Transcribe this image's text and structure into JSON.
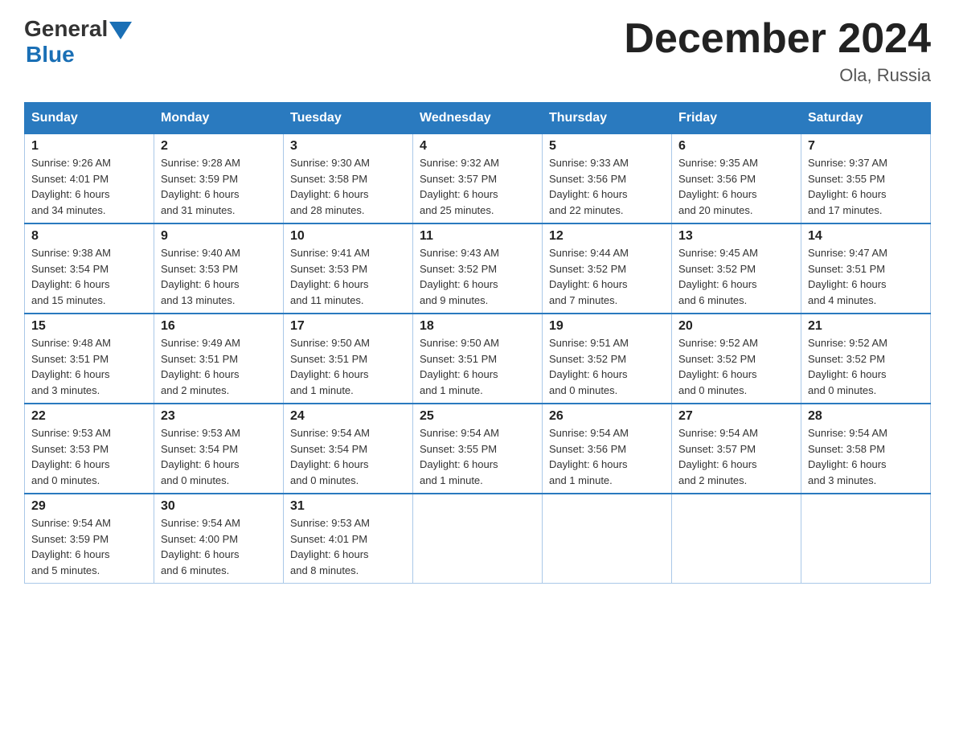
{
  "header": {
    "logo_general": "General",
    "logo_blue": "Blue",
    "month_title": "December 2024",
    "location": "Ola, Russia"
  },
  "days_of_week": [
    "Sunday",
    "Monday",
    "Tuesday",
    "Wednesday",
    "Thursday",
    "Friday",
    "Saturday"
  ],
  "weeks": [
    [
      {
        "day": "1",
        "sunrise": "9:26 AM",
        "sunset": "4:01 PM",
        "daylight": "6 hours and 34 minutes."
      },
      {
        "day": "2",
        "sunrise": "9:28 AM",
        "sunset": "3:59 PM",
        "daylight": "6 hours and 31 minutes."
      },
      {
        "day": "3",
        "sunrise": "9:30 AM",
        "sunset": "3:58 PM",
        "daylight": "6 hours and 28 minutes."
      },
      {
        "day": "4",
        "sunrise": "9:32 AM",
        "sunset": "3:57 PM",
        "daylight": "6 hours and 25 minutes."
      },
      {
        "day": "5",
        "sunrise": "9:33 AM",
        "sunset": "3:56 PM",
        "daylight": "6 hours and 22 minutes."
      },
      {
        "day": "6",
        "sunrise": "9:35 AM",
        "sunset": "3:56 PM",
        "daylight": "6 hours and 20 minutes."
      },
      {
        "day": "7",
        "sunrise": "9:37 AM",
        "sunset": "3:55 PM",
        "daylight": "6 hours and 17 minutes."
      }
    ],
    [
      {
        "day": "8",
        "sunrise": "9:38 AM",
        "sunset": "3:54 PM",
        "daylight": "6 hours and 15 minutes."
      },
      {
        "day": "9",
        "sunrise": "9:40 AM",
        "sunset": "3:53 PM",
        "daylight": "6 hours and 13 minutes."
      },
      {
        "day": "10",
        "sunrise": "9:41 AM",
        "sunset": "3:53 PM",
        "daylight": "6 hours and 11 minutes."
      },
      {
        "day": "11",
        "sunrise": "9:43 AM",
        "sunset": "3:52 PM",
        "daylight": "6 hours and 9 minutes."
      },
      {
        "day": "12",
        "sunrise": "9:44 AM",
        "sunset": "3:52 PM",
        "daylight": "6 hours and 7 minutes."
      },
      {
        "day": "13",
        "sunrise": "9:45 AM",
        "sunset": "3:52 PM",
        "daylight": "6 hours and 6 minutes."
      },
      {
        "day": "14",
        "sunrise": "9:47 AM",
        "sunset": "3:51 PM",
        "daylight": "6 hours and 4 minutes."
      }
    ],
    [
      {
        "day": "15",
        "sunrise": "9:48 AM",
        "sunset": "3:51 PM",
        "daylight": "6 hours and 3 minutes."
      },
      {
        "day": "16",
        "sunrise": "9:49 AM",
        "sunset": "3:51 PM",
        "daylight": "6 hours and 2 minutes."
      },
      {
        "day": "17",
        "sunrise": "9:50 AM",
        "sunset": "3:51 PM",
        "daylight": "6 hours and 1 minute."
      },
      {
        "day": "18",
        "sunrise": "9:50 AM",
        "sunset": "3:51 PM",
        "daylight": "6 hours and 1 minute."
      },
      {
        "day": "19",
        "sunrise": "9:51 AM",
        "sunset": "3:52 PM",
        "daylight": "6 hours and 0 minutes."
      },
      {
        "day": "20",
        "sunrise": "9:52 AM",
        "sunset": "3:52 PM",
        "daylight": "6 hours and 0 minutes."
      },
      {
        "day": "21",
        "sunrise": "9:52 AM",
        "sunset": "3:52 PM",
        "daylight": "6 hours and 0 minutes."
      }
    ],
    [
      {
        "day": "22",
        "sunrise": "9:53 AM",
        "sunset": "3:53 PM",
        "daylight": "6 hours and 0 minutes."
      },
      {
        "day": "23",
        "sunrise": "9:53 AM",
        "sunset": "3:54 PM",
        "daylight": "6 hours and 0 minutes."
      },
      {
        "day": "24",
        "sunrise": "9:54 AM",
        "sunset": "3:54 PM",
        "daylight": "6 hours and 0 minutes."
      },
      {
        "day": "25",
        "sunrise": "9:54 AM",
        "sunset": "3:55 PM",
        "daylight": "6 hours and 1 minute."
      },
      {
        "day": "26",
        "sunrise": "9:54 AM",
        "sunset": "3:56 PM",
        "daylight": "6 hours and 1 minute."
      },
      {
        "day": "27",
        "sunrise": "9:54 AM",
        "sunset": "3:57 PM",
        "daylight": "6 hours and 2 minutes."
      },
      {
        "day": "28",
        "sunrise": "9:54 AM",
        "sunset": "3:58 PM",
        "daylight": "6 hours and 3 minutes."
      }
    ],
    [
      {
        "day": "29",
        "sunrise": "9:54 AM",
        "sunset": "3:59 PM",
        "daylight": "6 hours and 5 minutes."
      },
      {
        "day": "30",
        "sunrise": "9:54 AM",
        "sunset": "4:00 PM",
        "daylight": "6 hours and 6 minutes."
      },
      {
        "day": "31",
        "sunrise": "9:53 AM",
        "sunset": "4:01 PM",
        "daylight": "6 hours and 8 minutes."
      },
      null,
      null,
      null,
      null
    ]
  ],
  "labels": {
    "sunrise": "Sunrise:",
    "sunset": "Sunset:",
    "daylight": "Daylight:"
  }
}
